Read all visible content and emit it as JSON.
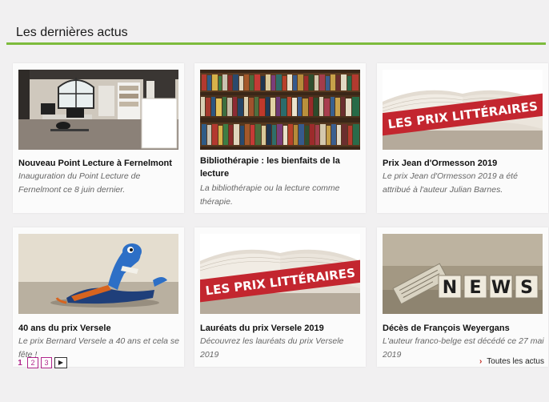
{
  "section": {
    "title": "Les dernières actus"
  },
  "cards": [
    {
      "title": "Nouveau Point Lecture à Fernelmont",
      "desc": "Inauguration du Point Lecture de Fernelmont ce 8 juin dernier.",
      "image": "library-room"
    },
    {
      "title": "Bibliothérapie : les bienfaits de la lecture",
      "desc": "La bibliothérapie ou la lecture comme thérapie.",
      "image": "bookshelves"
    },
    {
      "title": "Prix Jean d'Ormesson 2019",
      "desc": "Le prix Jean d'Ormesson 2019 a été attribué à l'auteur Julian Barnes.",
      "image": "prix-litteraires-book",
      "banner": "LES PRIX LITTÉRAIRES"
    },
    {
      "title": "40 ans du prix Versele",
      "desc": "Le prix Bernard Versele a 40 ans et cela se fête !",
      "image": "blue-bird-toy"
    },
    {
      "title": "Lauréats du prix Versele 2019",
      "desc": "Découvrez les lauréats du prix Versele 2019",
      "image": "prix-litteraires-book",
      "banner": "LES PRIX LITTÉRAIRES"
    },
    {
      "title": "Décès de François Weyergans",
      "desc": "L'auteur franco-belge est décédé ce 27 mai 2019",
      "image": "news-cubes",
      "news_letters": [
        "N",
        "E",
        "W",
        "S"
      ]
    }
  ],
  "pagination": {
    "current": "1",
    "pages": [
      "2",
      "3"
    ],
    "next_icon": "play-icon"
  },
  "all_news": {
    "label": "Toutes les actus",
    "icon": "chevron-right-icon"
  },
  "colors": {
    "accent_green": "#7dbb3c",
    "accent_magenta": "#b0258a",
    "banner_red": "#c3262f"
  }
}
